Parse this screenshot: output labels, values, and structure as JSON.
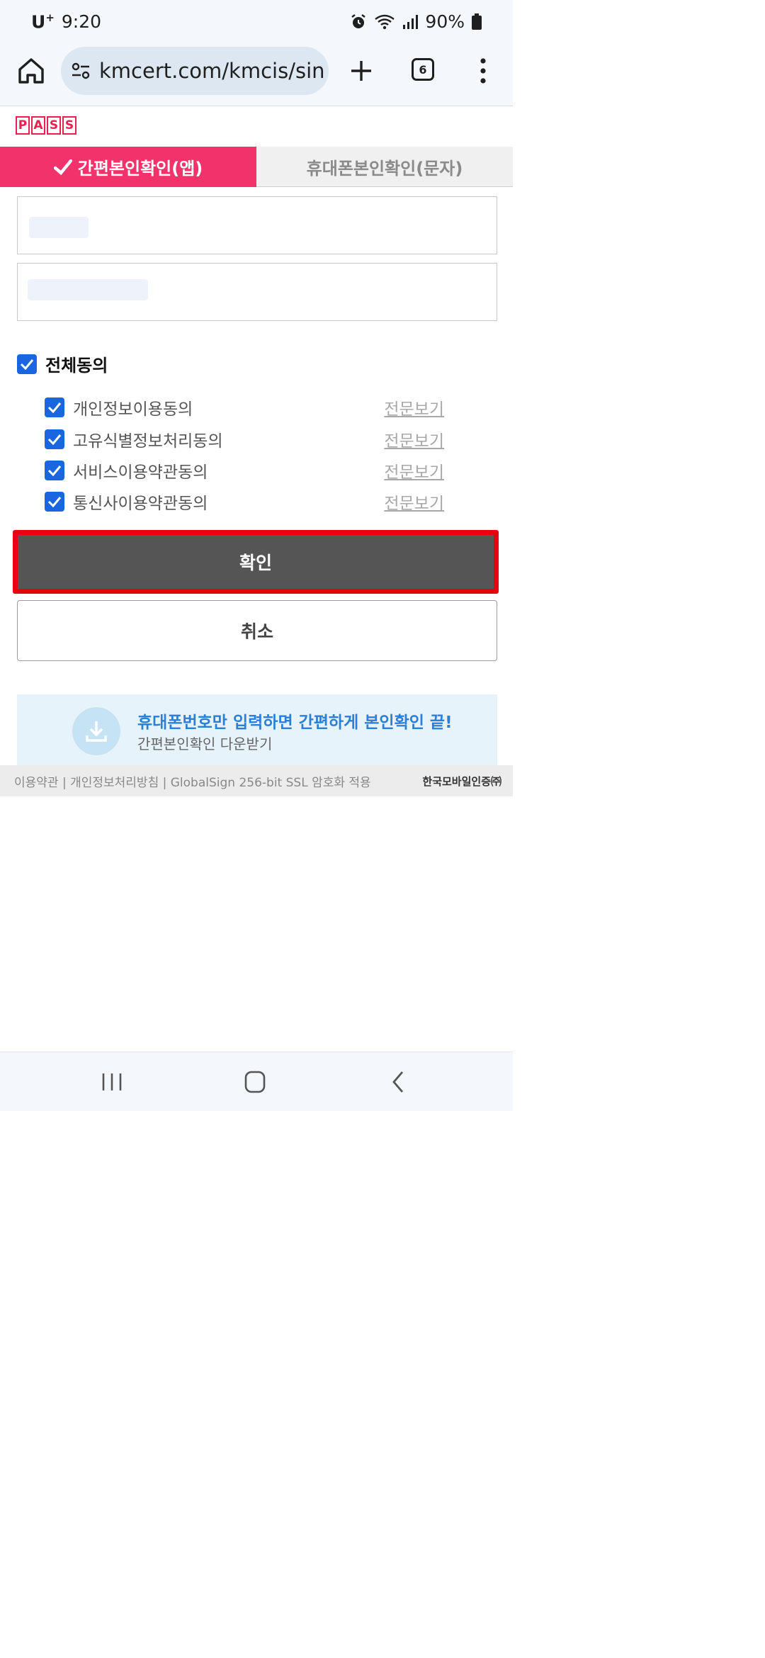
{
  "status_bar": {
    "carrier": "U",
    "carrier_sup": "+",
    "time": "9:20",
    "battery": "90%",
    "icons": [
      "alarm-icon",
      "wifi-icon",
      "signal-icon",
      "battery-icon"
    ]
  },
  "browser": {
    "url": "kmcert.com/kmcis/sin",
    "tab_count": "6",
    "icons": [
      "home-icon",
      "site-settings-icon",
      "plus-icon",
      "more-vert-icon"
    ]
  },
  "page": {
    "logo_letters": [
      "P",
      "A",
      "S",
      "S"
    ],
    "tabs": {
      "active": "간편본인확인(앱)",
      "inactive": "휴대폰본인확인(문자)"
    },
    "agree_all": "전체동의",
    "terms": [
      {
        "label": "개인정보이용동의",
        "link": "전문보기"
      },
      {
        "label": "고유식별정보처리동의",
        "link": "전문보기"
      },
      {
        "label": "서비스이용약관동의",
        "link": "전문보기"
      },
      {
        "label": "통신사이용약관동의",
        "link": "전문보기"
      }
    ],
    "confirm_label": "확인",
    "cancel_label": "취소",
    "banner": {
      "title": "휴대폰번호만 입력하면 간편하게 본인확인 끝!",
      "subtitle": "간편본인확인 다운받기"
    },
    "footer": {
      "links": "이용약관 | 개인정보처리방침 | GlobalSign 256-bit SSL 암호화 적용",
      "brand": "한국모바일인증㈜"
    }
  },
  "colors": {
    "accent": "#f2326a",
    "checkbox": "#1a66e0",
    "highlight": "#e60012",
    "confirm_bg": "#555555"
  }
}
